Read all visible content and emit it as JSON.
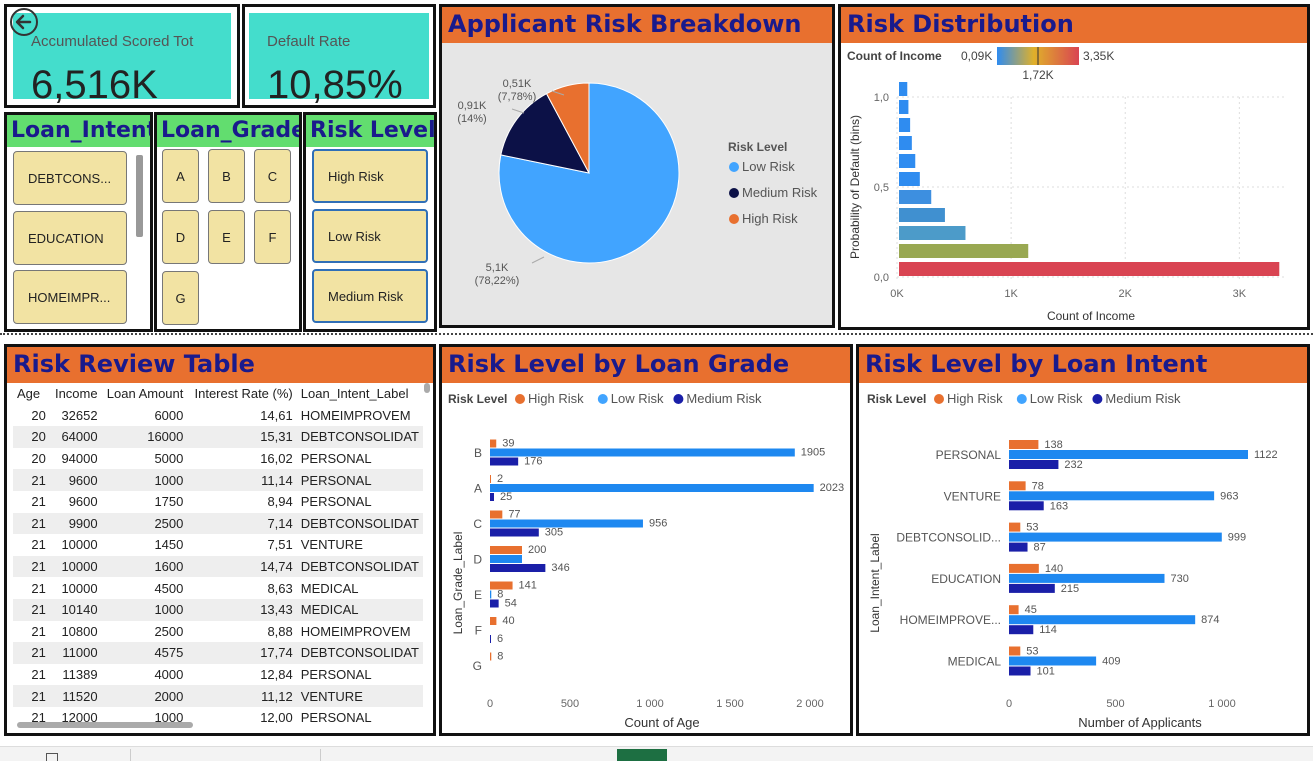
{
  "kpis": [
    {
      "title": "Accumulated Scored Tot",
      "value": "6,516K"
    },
    {
      "title": "Default Rate",
      "value": "10,85%"
    }
  ],
  "slicers": {
    "loan_intent": {
      "title": "Loan_Intent",
      "items": [
        "DEBTCONS...",
        "EDUCATION",
        "HOMEIMPR..."
      ]
    },
    "loan_grade": {
      "title": "Loan_Grade",
      "items": [
        "A",
        "B",
        "C",
        "D",
        "E",
        "F",
        "G"
      ]
    },
    "risk_level": {
      "title": "Risk Level",
      "items": [
        "High Risk",
        "Low Risk",
        "Medium Risk"
      ]
    }
  },
  "colors": {
    "low": "#41a4ff",
    "medium": "#0c1147",
    "high": "#e8702f",
    "orange_header": "#e8702f",
    "blue_bar": "#1e88f0",
    "navy_bar": "#1a1fa8"
  },
  "pie": {
    "title": "Applicant Risk Breakdown",
    "legend_title": "Risk Level",
    "slices": [
      {
        "name": "Low Risk",
        "value": 5.1,
        "label_value": "5,1K",
        "label_pct": "(78,22%)"
      },
      {
        "name": "Medium Risk",
        "value": 0.91,
        "label_value": "0,91K",
        "label_pct": "(14%)"
      },
      {
        "name": "High Risk",
        "value": 0.51,
        "label_value": "0,51K",
        "label_pct": "(7,78%)"
      }
    ]
  },
  "distribution": {
    "title": "Risk Distribution",
    "gradient_label": "Count of Income",
    "gradient_min": "0,09K",
    "gradient_max": "3,35K",
    "gradient_mid": "1,72K",
    "ylabel": "Probability of Default (bins)",
    "xlabel": "Count of Income",
    "yticks": [
      "1,0",
      "0,5",
      "0,0"
    ],
    "xticks": [
      "0K",
      "1K",
      "2K",
      "3K"
    ]
  },
  "table": {
    "title": "Risk Review Table",
    "columns": [
      "Age",
      "Income",
      "Loan Amount",
      "Interest Rate (%)",
      "Loan_Intent_Label"
    ],
    "rows": [
      [
        "20",
        "32652",
        "6000",
        "14,61",
        "HOMEIMPROVEM"
      ],
      [
        "20",
        "64000",
        "16000",
        "15,31",
        "DEBTCONSOLIDAT"
      ],
      [
        "20",
        "94000",
        "5000",
        "16,02",
        "PERSONAL"
      ],
      [
        "21",
        "9600",
        "1000",
        "11,14",
        "PERSONAL"
      ],
      [
        "21",
        "9600",
        "1750",
        "8,94",
        "PERSONAL"
      ],
      [
        "21",
        "9900",
        "2500",
        "7,14",
        "DEBTCONSOLIDAT"
      ],
      [
        "21",
        "10000",
        "1450",
        "7,51",
        "VENTURE"
      ],
      [
        "21",
        "10000",
        "1600",
        "14,74",
        "DEBTCONSOLIDAT"
      ],
      [
        "21",
        "10000",
        "4500",
        "8,63",
        "MEDICAL"
      ],
      [
        "21",
        "10140",
        "1000",
        "13,43",
        "MEDICAL"
      ],
      [
        "21",
        "10800",
        "2500",
        "8,88",
        "HOMEIMPROVEM"
      ],
      [
        "21",
        "11000",
        "4575",
        "17,74",
        "DEBTCONSOLIDAT"
      ],
      [
        "21",
        "11389",
        "4000",
        "12,84",
        "PERSONAL"
      ],
      [
        "21",
        "11520",
        "2000",
        "11,12",
        "VENTURE"
      ],
      [
        "21",
        "12000",
        "1000",
        "12,00",
        "PERSONAL"
      ]
    ]
  },
  "chart_data": [
    {
      "type": "pie",
      "title": "Applicant Risk Breakdown",
      "categories": [
        "Low Risk",
        "Medium Risk",
        "High Risk"
      ],
      "values": [
        5100,
        910,
        510
      ],
      "legend": "right"
    },
    {
      "type": "bar",
      "title": "Risk Distribution",
      "orientation": "horizontal",
      "xlabel": "Count of Income",
      "ylabel": "Probability of Default (bins)",
      "xlim": [
        0,
        3400
      ],
      "ylim": [
        0,
        1
      ],
      "bins": [
        0.0,
        0.1,
        0.2,
        0.3,
        0.4,
        0.5,
        0.6,
        0.7,
        0.8,
        0.9,
        1.0
      ],
      "values": [
        3350,
        1150,
        600,
        420,
        300,
        200,
        160,
        130,
        115,
        100,
        90
      ],
      "colors": [
        "#d94452",
        "#99a852",
        "#4c9bc9",
        "#4090d0",
        "#3d8fe0",
        "#2f8cf0",
        "#2f8cf0",
        "#2f8cf0",
        "#2f8cf0",
        "#2f8cf0",
        "#2f8cf0"
      ]
    },
    {
      "type": "bar",
      "title": "Risk Level by Loan Grade",
      "orientation": "horizontal",
      "legend_title": "Risk Level",
      "legend": "top-left",
      "xlabel": "Count of Age",
      "ylabel": "Loan_Grade_Label",
      "xticks": [
        "0",
        "500",
        "1 000",
        "1 500",
        "2 000"
      ],
      "xlim": [
        0,
        2150
      ],
      "categories": [
        "B",
        "A",
        "C",
        "D",
        "E",
        "F",
        "G"
      ],
      "series": [
        {
          "name": "High Risk",
          "values": [
            39,
            2,
            77,
            200,
            141,
            40,
            8
          ]
        },
        {
          "name": "Low Risk",
          "values": [
            1905,
            2023,
            956,
            200,
            8,
            0,
            0
          ]
        },
        {
          "name": "Medium Risk",
          "values": [
            176,
            25,
            305,
            346,
            54,
            6,
            0
          ]
        }
      ]
    },
    {
      "type": "bar",
      "title": "Risk Level by Loan Intent",
      "orientation": "horizontal",
      "legend_title": "Risk Level",
      "legend": "top-left",
      "xlabel": "Number of Applicants",
      "ylabel": "Loan_Intent_Label",
      "xticks": [
        "0",
        "500",
        "1 000"
      ],
      "xlim": [
        0,
        1230
      ],
      "categories": [
        "PERSONAL",
        "VENTURE",
        "DEBTCONSOLID...",
        "EDUCATION",
        "HOMEIMPROVE...",
        "MEDICAL"
      ],
      "series": [
        {
          "name": "High Risk",
          "values": [
            138,
            78,
            53,
            140,
            45,
            53
          ]
        },
        {
          "name": "Low Risk",
          "values": [
            1122,
            963,
            999,
            730,
            874,
            409
          ]
        },
        {
          "name": "Medium Risk",
          "values": [
            232,
            163,
            87,
            215,
            114,
            101
          ]
        }
      ]
    }
  ]
}
